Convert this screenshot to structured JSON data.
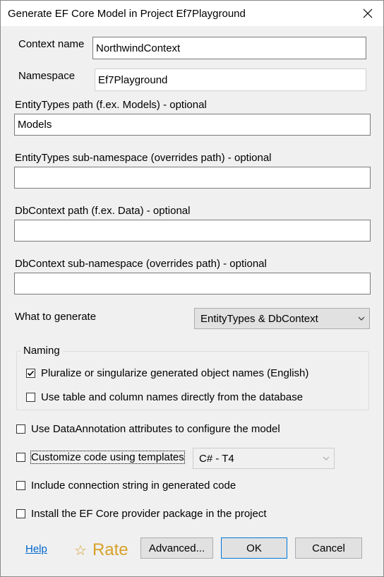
{
  "window": {
    "title": "Generate EF Core Model in Project Ef7Playground"
  },
  "fields": {
    "context_name": {
      "label": "Context name",
      "value": "NorthwindContext"
    },
    "namespace": {
      "label": "Namespace",
      "value": "Ef7Playground"
    },
    "entity_types_path": {
      "label": "EntityTypes path (f.ex. Models) - optional",
      "value": "Models"
    },
    "entity_types_subnamespace": {
      "label": "EntityTypes sub-namespace (overrides path) - optional",
      "value": ""
    },
    "dbcontext_path": {
      "label": "DbContext path (f.ex. Data) - optional",
      "value": ""
    },
    "dbcontext_subnamespace": {
      "label": "DbContext sub-namespace (overrides path) - optional",
      "value": ""
    }
  },
  "what_to_generate": {
    "label": "What to generate",
    "selected": "EntityTypes & DbContext"
  },
  "naming": {
    "title": "Naming",
    "pluralize": {
      "label": "Pluralize or singularize generated object names (English)",
      "checked": true
    },
    "use_db_names": {
      "label": "Use table and column names directly from the database",
      "checked": false
    }
  },
  "options": {
    "data_annotations": {
      "label": "Use DataAnnotation attributes to configure the model",
      "checked": false
    },
    "customize_templates": {
      "label": "Customize code using templates",
      "checked": false
    },
    "template_selected": "C# - T4",
    "include_connection_string": {
      "label": "Include connection string in generated code",
      "checked": false
    },
    "install_provider": {
      "label": "Install the EF Core provider package in the project",
      "checked": false
    }
  },
  "footer": {
    "help": "Help",
    "rate_icon": "☆",
    "rate": "Rate",
    "advanced": "Advanced...",
    "ok": "OK",
    "cancel": "Cancel"
  },
  "colors": {
    "accent": "#0078d7",
    "link": "#0066cc",
    "rate": "#d7a12a"
  }
}
